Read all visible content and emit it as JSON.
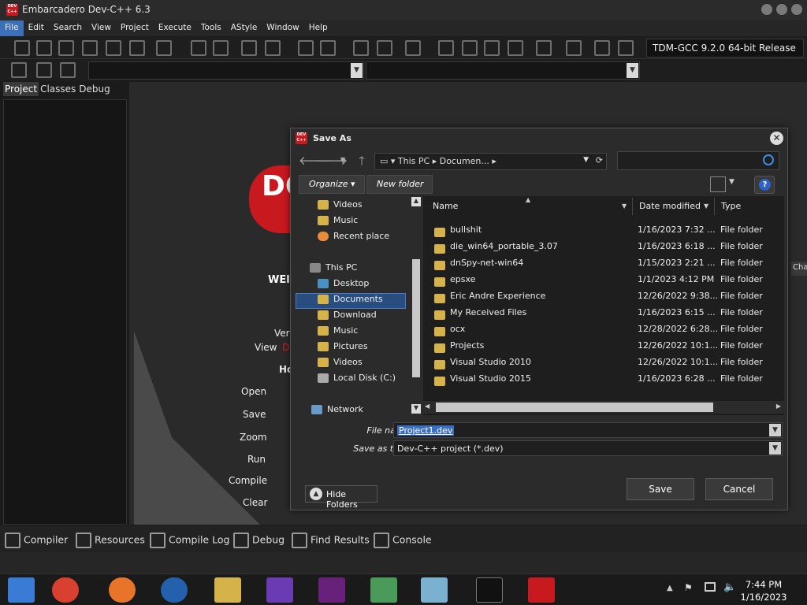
{
  "app": {
    "title": "Embarcadero Dev-C++ 6.3",
    "logo_text": "DEV C++"
  },
  "menu": [
    "File",
    "Edit",
    "Search",
    "View",
    "Project",
    "Execute",
    "Tools",
    "AStyle",
    "Window",
    "Help"
  ],
  "compiler": {
    "selected": "TDM-GCC 9.2.0 64-bit Release"
  },
  "left_tabs": [
    "Project",
    "Classes",
    "Debug"
  ],
  "welcome": {
    "logo": "DC",
    "heading": "WEl",
    "fragments": [
      "Ver",
      "View",
      "D",
      "Ho"
    ],
    "actions": [
      "Open",
      "Save",
      "Zoom",
      "Run",
      "Compile",
      "Clear"
    ]
  },
  "bottom_tabs": [
    "Compiler",
    "Resources",
    "Compile Log",
    "Debug",
    "Find Results",
    "Console"
  ],
  "side_right": {
    "label": "Cha"
  },
  "dialog": {
    "title": "Save As",
    "address": {
      "root": "This PC",
      "current": "Documen..."
    },
    "toolbar": {
      "organize": "Organize",
      "new_folder": "New folder"
    },
    "nav_items": [
      {
        "label": "Videos",
        "kind": "folder"
      },
      {
        "label": "Music",
        "kind": "folder"
      },
      {
        "label": "Recent place",
        "kind": "recent"
      },
      {
        "label": "This PC",
        "kind": "pc"
      },
      {
        "label": "Desktop",
        "kind": "folder"
      },
      {
        "label": "Documents",
        "kind": "folder",
        "selected": true
      },
      {
        "label": "Download",
        "kind": "folder"
      },
      {
        "label": "Music",
        "kind": "folder"
      },
      {
        "label": "Pictures",
        "kind": "folder"
      },
      {
        "label": "Videos",
        "kind": "folder"
      },
      {
        "label": "Local Disk (C:)",
        "kind": "drive"
      },
      {
        "label": "Network",
        "kind": "network"
      }
    ],
    "columns": {
      "name": "Name",
      "date": "Date modified",
      "type": "Type"
    },
    "files": [
      {
        "name": "bullshit",
        "date": "1/16/2023 7:32 ...",
        "type": "File folder"
      },
      {
        "name": "die_win64_portable_3.07",
        "date": "1/16/2023 6:18 ...",
        "type": "File folder"
      },
      {
        "name": "dnSpy-net-win64",
        "date": "1/15/2023 2:21 ...",
        "type": "File folder"
      },
      {
        "name": "epsxe",
        "date": "1/1/2023 4:12 PM",
        "type": "File folder"
      },
      {
        "name": "Eric Andre Experience",
        "date": "12/26/2022 9:38...",
        "type": "File folder"
      },
      {
        "name": "My Received Files",
        "date": "1/16/2023 6:15 ...",
        "type": "File folder"
      },
      {
        "name": "ocx",
        "date": "12/28/2022 6:28...",
        "type": "File folder"
      },
      {
        "name": "Projects",
        "date": "12/26/2022 10:1...",
        "type": "File folder"
      },
      {
        "name": "Visual Studio 2010",
        "date": "12/26/2022 10:1...",
        "type": "File folder"
      },
      {
        "name": "Visual Studio 2015",
        "date": "1/16/2023 6:28 ...",
        "type": "File folder"
      }
    ],
    "file_name_label": "File name:",
    "file_name": "Project1.dev",
    "save_type_label": "Save as type:",
    "save_type": "Dev-C++ project (*.dev)",
    "hide_folders": "Hide Folders",
    "save": "Save",
    "cancel": "Cancel"
  },
  "taskbar": {
    "time": "7:44 PM",
    "date": "1/16/2023"
  },
  "colors": {
    "accent": "#3d6fb6",
    "brand_red": "#c8191f",
    "folder": "#d6b34a"
  }
}
